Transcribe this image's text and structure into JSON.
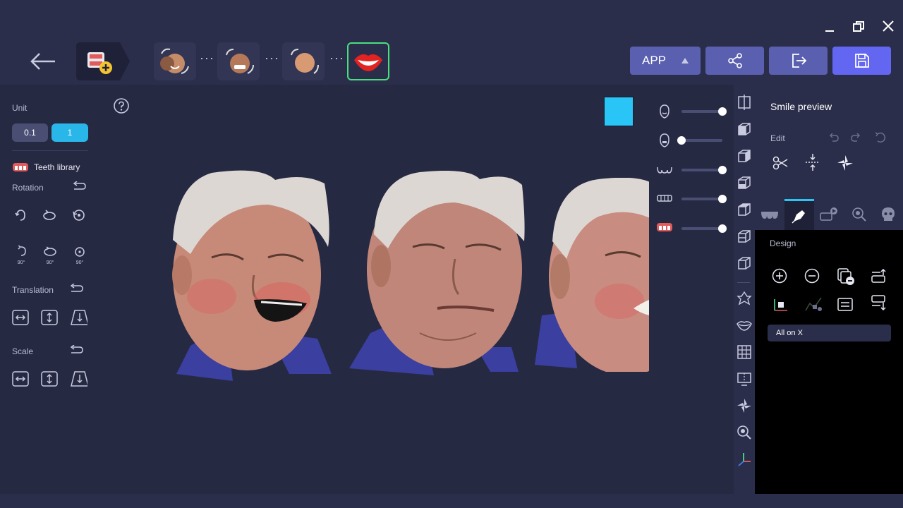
{
  "toolbar": {
    "app_label": "APP",
    "accent": "#6366f1",
    "active_stage_color": "#4ade80"
  },
  "left": {
    "unit_label": "Unit",
    "unit_options": [
      "0.1",
      "1"
    ],
    "selected_unit": "1",
    "teeth_library_label": "Teeth library",
    "rotation_label": "Rotation",
    "rotation_90_labels": [
      "90°",
      "90°",
      "90°"
    ],
    "translation_label": "Translation",
    "scale_label": "Scale"
  },
  "viewport": {
    "color_swatch": "#29c5f6",
    "sliders": [
      {
        "icon": "face-icon",
        "level": 1.0
      },
      {
        "icon": "face-outline-icon",
        "level": 0.0
      },
      {
        "icon": "upper-teeth-icon",
        "level": 1.0
      },
      {
        "icon": "lower-teeth-icon",
        "level": 1.0
      },
      {
        "icon": "denture-icon",
        "level": 1.0
      }
    ]
  },
  "right": {
    "title": "Smile preview",
    "edit_label": "Edit",
    "design_label": "Design",
    "dropdown_value": "All on X"
  }
}
